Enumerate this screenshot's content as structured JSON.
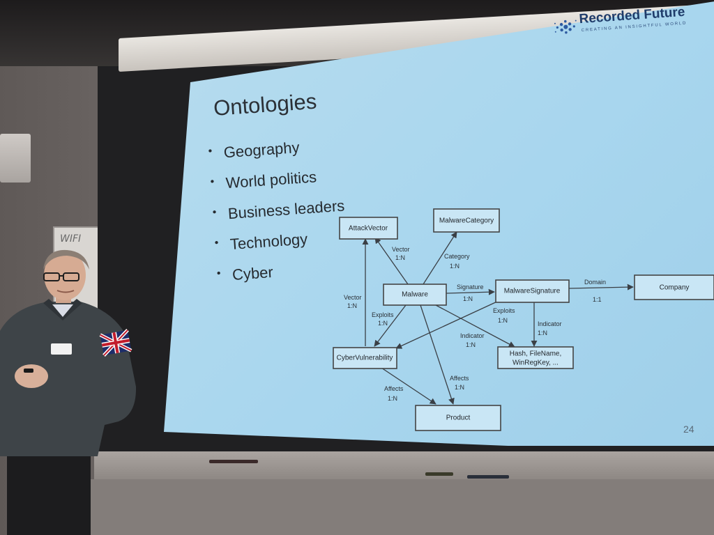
{
  "slide": {
    "title": "Ontologies",
    "bullets": [
      "Geography",
      "World politics",
      "Business leaders",
      "Technology",
      "Cyber"
    ],
    "logo_name": "Recorded Future",
    "logo_tagline": "CREATING AN INSIGHTFUL WORLD",
    "page_number": "24"
  },
  "diagram": {
    "nodes": {
      "attack_vector": "AttackVector",
      "malware_category": "MalwareCategory",
      "malware": "Malware",
      "malware_signature": "MalwareSignature",
      "company": "Company",
      "cyber_vulnerability": "CyberVulnerability",
      "hash_line1": "Hash, FileName,",
      "hash_line2": "WinRegKey, ...",
      "product": "Product"
    },
    "edges": {
      "vector_rel": "Vector",
      "vector_card": "1:N",
      "category_rel": "Category",
      "category_card": "1:N",
      "signature_rel": "Signature",
      "signature_card": "1:N",
      "domain_rel": "Domain",
      "domain_card": "1:1",
      "vector2_rel": "Vector",
      "vector2_card": "1:N",
      "exploits_rel": "Exploits",
      "exploits_card": "1:N",
      "exploits2_rel": "Exploits",
      "exploits2_card": "1:N",
      "indicator_rel": "Indicator",
      "indicator_card": "1:N",
      "indicator2_rel": "Indicator",
      "indicator2_card": "1:N",
      "affects_rel": "Affects",
      "affects_card": "1:N",
      "affects2_rel": "Affects",
      "affects2_card": "1:N"
    }
  },
  "room": {
    "whiteboard_text": "WIFI"
  },
  "colors": {
    "slide_bg": "#a8d6ee",
    "logo_blue": "#1f3c6a",
    "sweater": "#3e4448"
  }
}
